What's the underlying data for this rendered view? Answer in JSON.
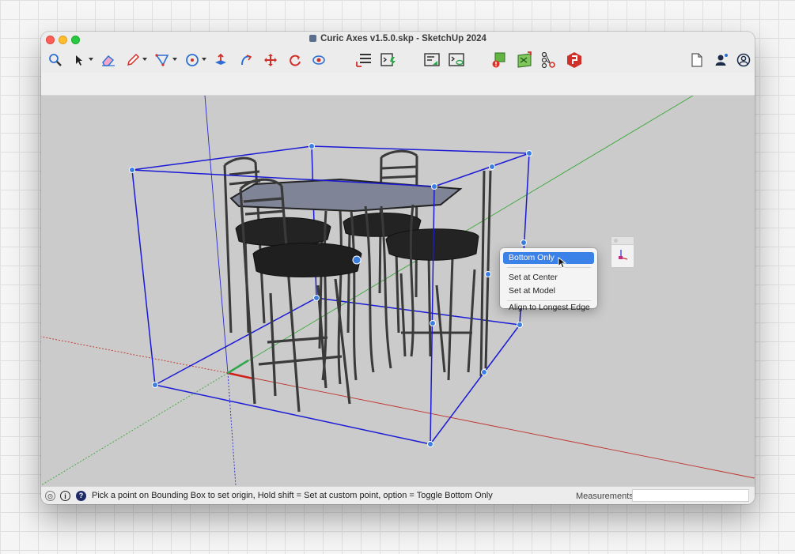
{
  "window": {
    "title": "Curic Axes v1.5.0.skp - SketchUp 2024"
  },
  "toolbar": {
    "tools": [
      "search-icon",
      "select-icon",
      "eraser-icon",
      "pencil-icon",
      "shapes-icon",
      "tape-measure-icon",
      "push-pull-icon",
      "follow-me-icon",
      "move-icon",
      "rotate-icon",
      "lookaround-icon",
      "curic-axes-icon",
      "ruby-console-icon",
      "scenes-icon",
      "preview-icon",
      "extension-warning-icon",
      "extension-map-icon",
      "components-icon",
      "extension-warehouse-icon",
      "new-file-icon",
      "account-icon",
      "profile-icon"
    ]
  },
  "context_menu": {
    "items": [
      {
        "label": "Bottom Only",
        "selected": true
      },
      {
        "label": "Set at Center"
      },
      {
        "label": "Set at Model"
      },
      {
        "label": "Align to Longest Edge"
      }
    ]
  },
  "statusbar": {
    "hint": "Pick a point on Bounding Box to set origin, Hold shift = Set at custom point, option = Toggle Bottom Only",
    "measurements_label": "Measurements",
    "measurements_value": ""
  },
  "colors": {
    "bounding_box": "#1a1ad6",
    "axis_red": "#c0302a",
    "axis_green": "#3aa83a",
    "axis_blue": "#2a2ad0",
    "menu_highlight": "#3b82e8",
    "viewport_bg": "#cbcbcb"
  }
}
